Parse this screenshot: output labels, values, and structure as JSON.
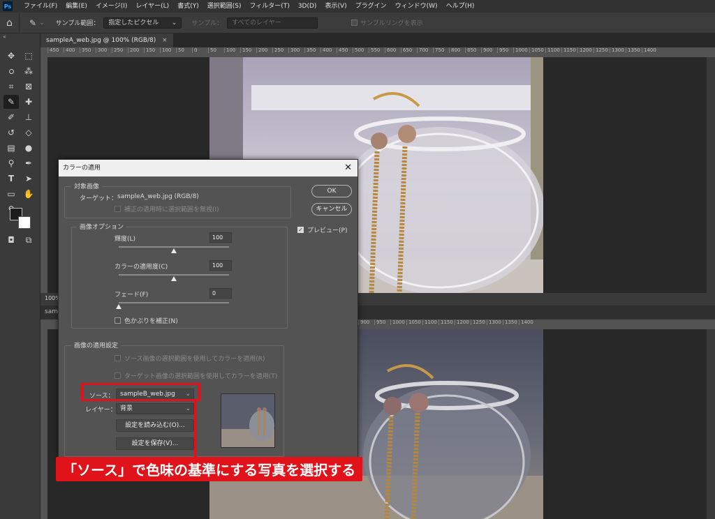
{
  "menu": {
    "logo": "Ps",
    "items": [
      "ファイル(F)",
      "編集(E)",
      "イメージ(I)",
      "レイヤー(L)",
      "書式(Y)",
      "選択範囲(S)",
      "フィルター(T)",
      "3D(D)",
      "表示(V)",
      "プラグイン",
      "ウィンドウ(W)",
      "ヘルプ(H)"
    ]
  },
  "options": {
    "sample_size_label": "サンプル範囲：",
    "sample_size_value": "指定したピクセル",
    "sample_label": "サンプル：",
    "sample_value": "すべてのレイヤー",
    "show_ring": "サンプルリングを表示"
  },
  "document": {
    "tab_title": "sampleA_web.jpg @ 100% (RGB/8)",
    "tab_close": "×",
    "zoom": "100%",
    "second_tab_fragment": "sam",
    "ruler_ticks": [
      "450",
      "400",
      "350",
      "300",
      "250",
      "200",
      "150",
      "100",
      "50",
      "0",
      "50",
      "100",
      "150",
      "200",
      "250",
      "300",
      "350",
      "400",
      "450",
      "500",
      "550",
      "600",
      "650",
      "700",
      "750",
      "800",
      "850",
      "900",
      "950",
      "1000",
      "1050",
      "1100",
      "1150",
      "1200",
      "1250",
      "1300",
      "1350",
      "1400"
    ],
    "ruler2_ticks": [
      "900",
      "950",
      "1000",
      "1050",
      "1100",
      "1150",
      "1200",
      "1250",
      "1300",
      "1350",
      "1400"
    ]
  },
  "dialog": {
    "title": "カラーの適用",
    "close": "✕",
    "target_group": {
      "title": "対象画像",
      "target_label": "ターゲット：",
      "target_value": "sampleA_web.jpg (RGB/8)",
      "ignore_selection": "補正の適用時に選択範囲を無視(I)"
    },
    "image_options": {
      "title": "画像オプション",
      "luminance_label": "輝度(L)",
      "luminance_value": "100",
      "luminance_pos": 0.5,
      "intensity_label": "カラーの適用度(C)",
      "intensity_value": "100",
      "intensity_pos": 0.5,
      "fade_label": "フェード(F)",
      "fade_value": "0",
      "fade_pos": 0.0,
      "neutralize": "色かぶりを補正(N)"
    },
    "stats": {
      "title": "画像の適用設定",
      "use_source_sel": "ソース画像の選択範囲を使用してカラーを適用(R)",
      "use_target_sel": "ターゲット画像の選択範囲を使用してカラーを適用(T)",
      "source_label": "ソース：",
      "source_value": "sampleB_web.jpg",
      "layer_label": "レイヤー：",
      "layer_value": "背景",
      "load_button": "設定を読み込む(O)...",
      "save_button": "設定を保存(V)..."
    },
    "ok": "OK",
    "cancel": "キャンセル",
    "preview": "プレビュー(P)",
    "checkmark": "✓"
  },
  "annotation": {
    "text": "「ソース」で色味の基準にする写真を選択する",
    "color": "#e0121a"
  },
  "icons": {
    "home": "⌂",
    "eyedropper": "✎",
    "chevron": "⌄"
  }
}
